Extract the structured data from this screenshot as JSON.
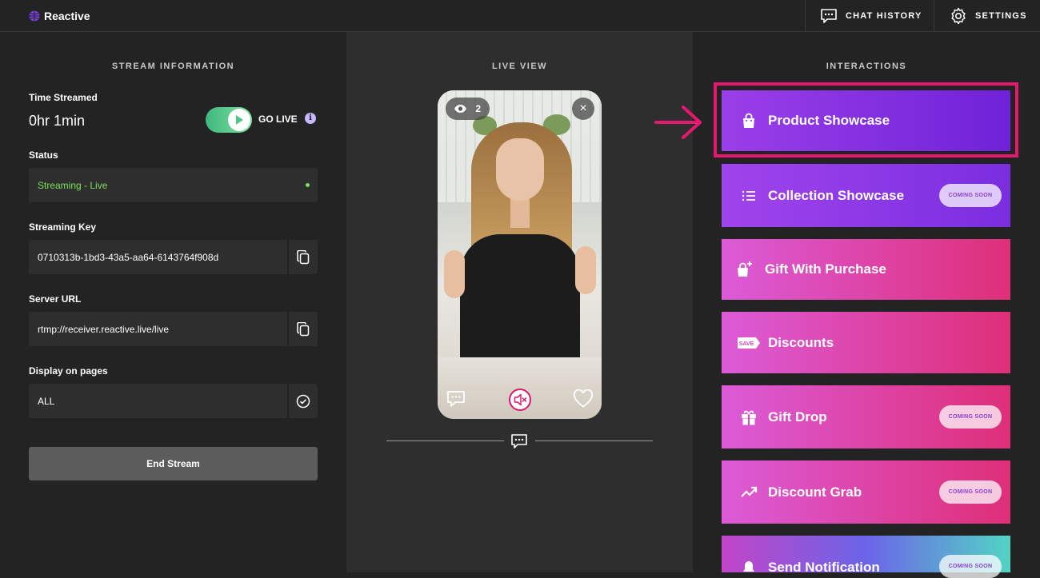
{
  "app": {
    "name": "Reactive"
  },
  "topbar": {
    "chat_history": "CHAT HISTORY",
    "settings": "SETTINGS"
  },
  "stream_info": {
    "title": "STREAM INFORMATION",
    "time_label": "Time Streamed",
    "time_value": "0hr 1min",
    "go_live_label": "GO LIVE",
    "info_icon": "i",
    "status_label": "Status",
    "status_value": "Streaming - Live",
    "key_label": "Streaming Key",
    "key_value": "0710313b-1bd3-43a5-aa64-6143764f908d",
    "server_label": "Server URL",
    "server_value": "rtmp://receiver.reactive.live/live",
    "pages_label": "Display on pages",
    "pages_value": "ALL",
    "end_button": "End Stream"
  },
  "live_view": {
    "title": "LIVE VIEW",
    "viewer_count": "2",
    "close": "×"
  },
  "interactions": {
    "title": "INTERACTIONS",
    "items": [
      {
        "label": "Product Showcase",
        "icon": "shopping-bag-icon",
        "badge": ""
      },
      {
        "label": "Collection Showcase",
        "icon": "list-icon",
        "badge": "COMING SOON"
      },
      {
        "label": "Gift With Purchase",
        "icon": "gift-bag-icon",
        "badge": ""
      },
      {
        "label": "Discounts",
        "icon": "save-tag-icon",
        "badge": ""
      },
      {
        "label": "Gift Drop",
        "icon": "gift-icon",
        "badge": "COMING SOON"
      },
      {
        "label": "Discount Grab",
        "icon": "trending-up-icon",
        "badge": "COMING SOON"
      },
      {
        "label": "Send Notification",
        "icon": "bell-icon",
        "badge": "COMING SOON"
      }
    ],
    "save_tag_text": "SAVE"
  },
  "colors": {
    "accent_green": "#7ee05b",
    "highlight": "#e5186f",
    "purple": "#7a2ee0",
    "pink": "#de2f78"
  }
}
